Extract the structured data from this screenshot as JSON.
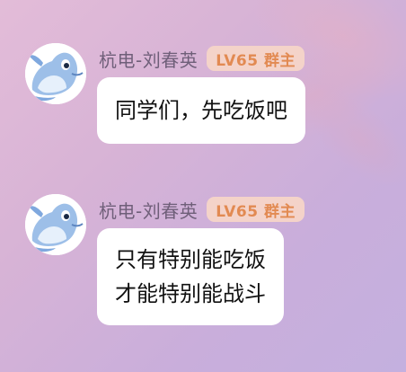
{
  "background": {
    "gradient_start": "#e3bcd8",
    "gradient_end": "#c4b0df"
  },
  "messages": [
    {
      "avatar_icon": "dolphin-icon",
      "sender": "杭电-刘春英",
      "badge": "LV65 群主",
      "lines": [
        "同学们，先吃饭吧"
      ]
    },
    {
      "avatar_icon": "dolphin-icon",
      "sender": "杭电-刘春英",
      "badge": "LV65 群主",
      "lines": [
        "只有特别能吃饭",
        "才能特别能战斗"
      ]
    }
  ],
  "colors": {
    "sender_name": "#6f5f79",
    "badge_bg": "#f4d3c9",
    "badge_text": "#e28a52",
    "bubble_bg": "#ffffff",
    "bubble_text": "#111111"
  }
}
